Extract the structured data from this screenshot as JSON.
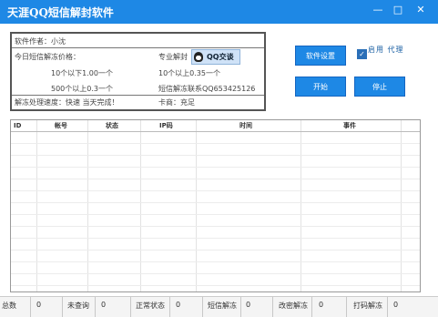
{
  "window": {
    "title": "天涯QQ短信解封软件",
    "minimize_glyph": "—",
    "maximize_glyph": "□",
    "close_glyph": "✕"
  },
  "info": {
    "author": "软件作者：小沈",
    "today_price": "今日短信解冻价格：",
    "pro_unlock": "专业解封",
    "qq_button": "QQ交谈",
    "price1_left": "10个以下1.00一个",
    "price1_right": "10个以上0.35一个",
    "price2_left": "500个以上0.3一个",
    "price2_right": "短信解冻联系QQ653425126",
    "speed": "解冻处理速度：快速 当天完成！",
    "merchant": "卡商：充足"
  },
  "controls": {
    "settings_label": "软件设置",
    "enable_proxy_label": "启用 代理",
    "enable_proxy_checked": true,
    "start_label": "开始",
    "stop_label": "停止"
  },
  "table": {
    "columns": [
      "ID",
      "帐号",
      "状态",
      "IP码",
      "时间",
      "事件"
    ],
    "rows": []
  },
  "statusbar": {
    "total_label": "总数",
    "total_value": "0",
    "unchecked_label": "未查询",
    "unchecked_value": "0",
    "normal_label": "正常状态",
    "normal_value": "0",
    "sms_label": "短信解冻",
    "sms_value": "0",
    "pwd_label": "改密解冻",
    "pwd_value": "0",
    "code_label": "打码解冻",
    "code_value": "0"
  }
}
